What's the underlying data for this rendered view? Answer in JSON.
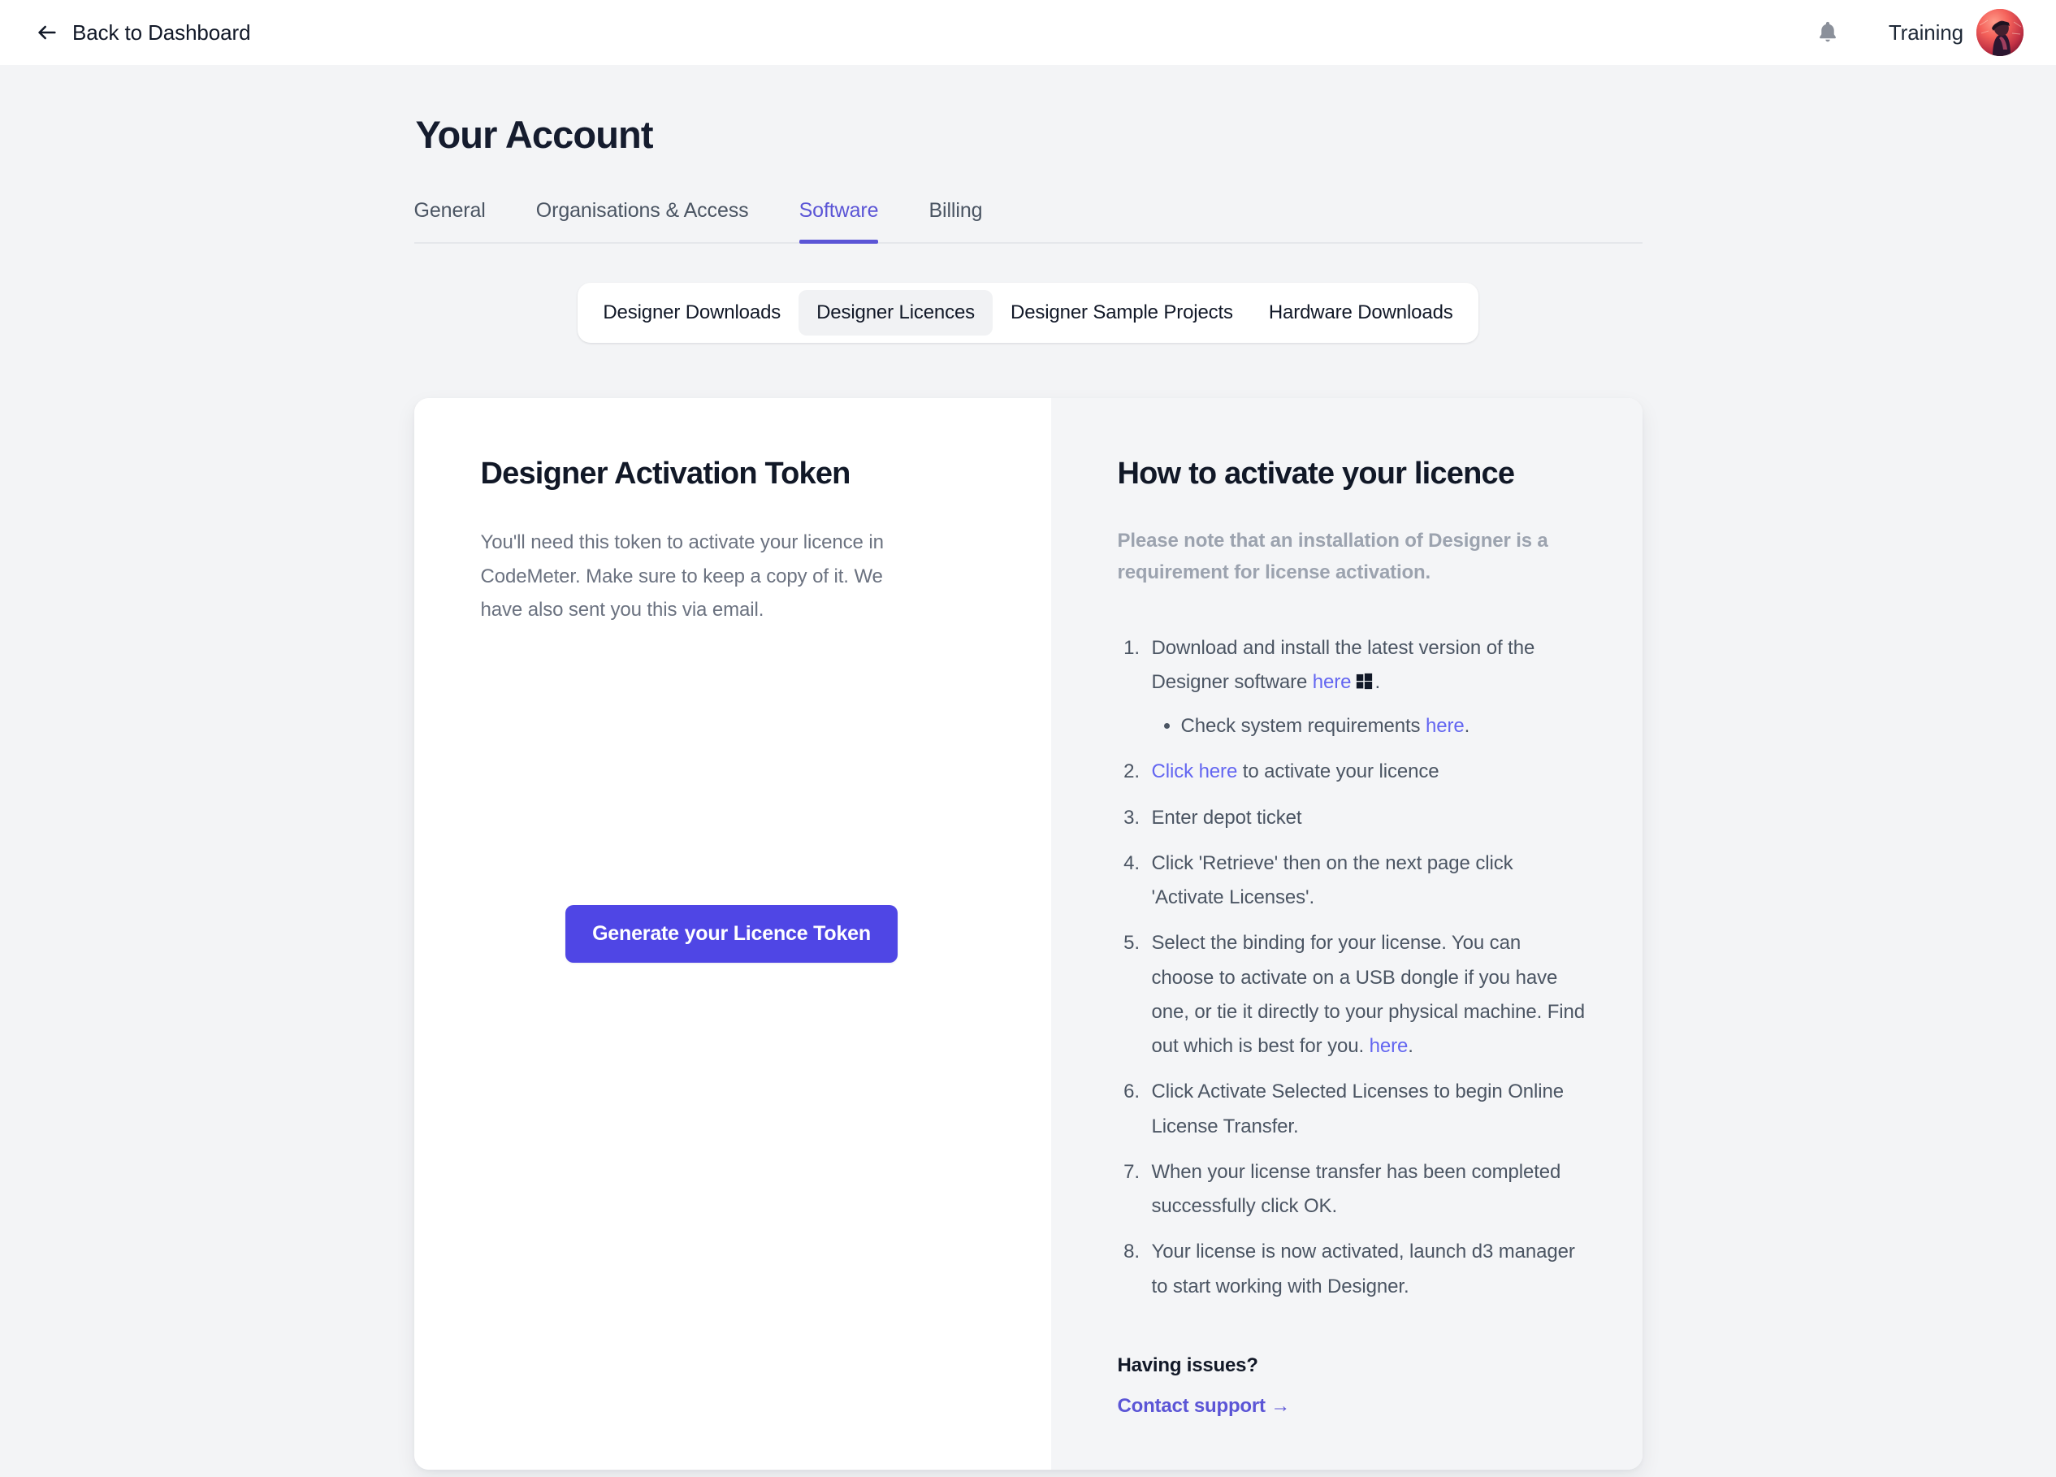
{
  "topbar": {
    "back_label": "Back to Dashboard",
    "back_arrow_icon": "arrow-left-icon",
    "bell_icon": "bell-icon",
    "user_name": "Training",
    "avatar_icon": "user-avatar"
  },
  "page": {
    "title": "Your Account"
  },
  "tabs": [
    {
      "label": "General",
      "active": false
    },
    {
      "label": "Organisations & Access",
      "active": false
    },
    {
      "label": "Software",
      "active": true
    },
    {
      "label": "Billing",
      "active": false
    }
  ],
  "segmented": [
    {
      "label": "Designer Downloads",
      "active": false
    },
    {
      "label": "Designer Licences",
      "active": true
    },
    {
      "label": "Designer Sample Projects",
      "active": false
    },
    {
      "label": "Hardware Downloads",
      "active": false
    }
  ],
  "left_panel": {
    "title": "Designer Activation Token",
    "description": "You'll need this token to activate your licence in CodeMeter. Make sure to keep a copy of it. We have also sent you this via email.",
    "button_label": "Generate your Licence Token"
  },
  "right_panel": {
    "title": "How to activate your licence",
    "note": "Please note that an installation of Designer is a requirement for license activation.",
    "steps": [
      {
        "text_before": "Download and install the latest version of the Designer software ",
        "link": "here",
        "icon": "windows-icon",
        "text_after": ".",
        "substeps": [
          {
            "text_before": "Check system requirements ",
            "link": "here",
            "text_after": "."
          }
        ]
      },
      {
        "link_first": "Click here",
        "text_after": " to activate your licence"
      },
      {
        "text": "Enter depot ticket"
      },
      {
        "text": "Click 'Retrieve' then on the next page click 'Activate Licenses'."
      },
      {
        "text_before": "Select the binding for your license. You can choose to activate on a USB dongle if you have one, or tie it directly to your physical machine. Find out which is best for you. ",
        "link": "here",
        "text_after": "."
      },
      {
        "text": "Click Activate Selected Licenses to begin Online License Transfer."
      },
      {
        "text": "When your license transfer has been completed successfully click OK."
      },
      {
        "text": "Your license is now activated, launch d3 manager to start working with Designer."
      }
    ],
    "having_issues": "Having issues?",
    "contact_support": "Contact support →"
  },
  "colors": {
    "accent": "#5b55d6",
    "button": "#4f46e5",
    "link": "#6366f1",
    "page_bg": "#f3f4f6",
    "panel_bg": "#f4f5f7"
  }
}
